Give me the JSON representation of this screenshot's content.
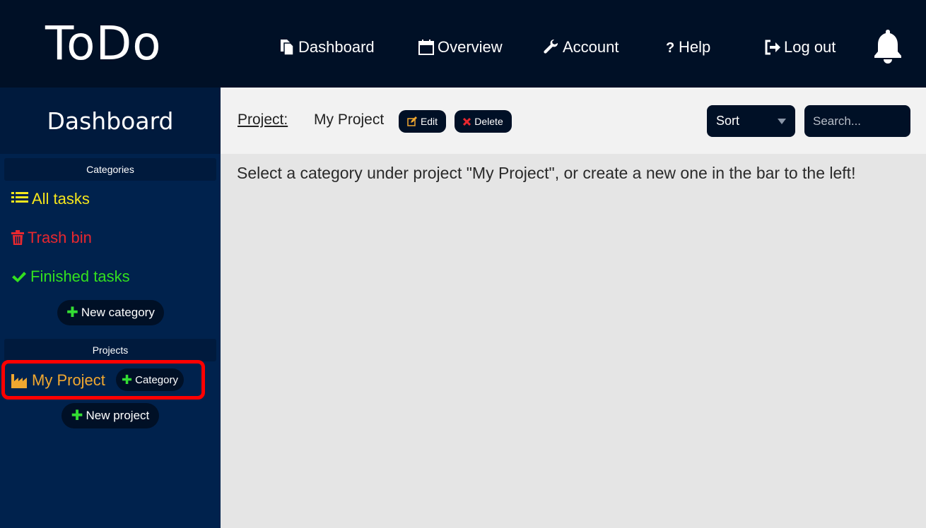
{
  "app": {
    "logo": "ToDo"
  },
  "nav": {
    "dashboard": "Dashboard",
    "overview": "Overview",
    "account": "Account",
    "help": "Help",
    "logout": "Log out"
  },
  "sidebar": {
    "title": "Dashboard",
    "categories_label": "Categories",
    "all_tasks": "All tasks",
    "trash_bin": "Trash bin",
    "finished_tasks": "Finished tasks",
    "new_category": "New category",
    "projects_label": "Projects",
    "project_name": "My Project",
    "project_category_button": "Category",
    "new_project": "New project"
  },
  "main": {
    "project_label": "Project:",
    "project_name": "My Project",
    "edit_label": "Edit",
    "delete_label": "Delete",
    "sort_label": "Sort",
    "search_placeholder": "Search...",
    "message": "Select a category under project \"My Project\", or create a new one in the bar to the left!"
  },
  "colors": {
    "topbar": "#001026",
    "sidebar": "#00224d",
    "all_tasks": "#f5e61c",
    "trash_bin": "#e8282f",
    "finished_tasks": "#33e01f",
    "project": "#f0a830",
    "highlight": "#ff0000"
  },
  "icons": {
    "dashboard": "copy-icon",
    "overview": "calendar-icon",
    "account": "wrench-icon",
    "help": "question-icon",
    "logout": "sign-out-icon",
    "notifications": "bell-icon",
    "all_tasks": "list-icon",
    "trash_bin": "trash-icon",
    "finished_tasks": "check-icon",
    "project": "industry-icon",
    "edit": "edit-icon",
    "delete": "close-icon"
  }
}
